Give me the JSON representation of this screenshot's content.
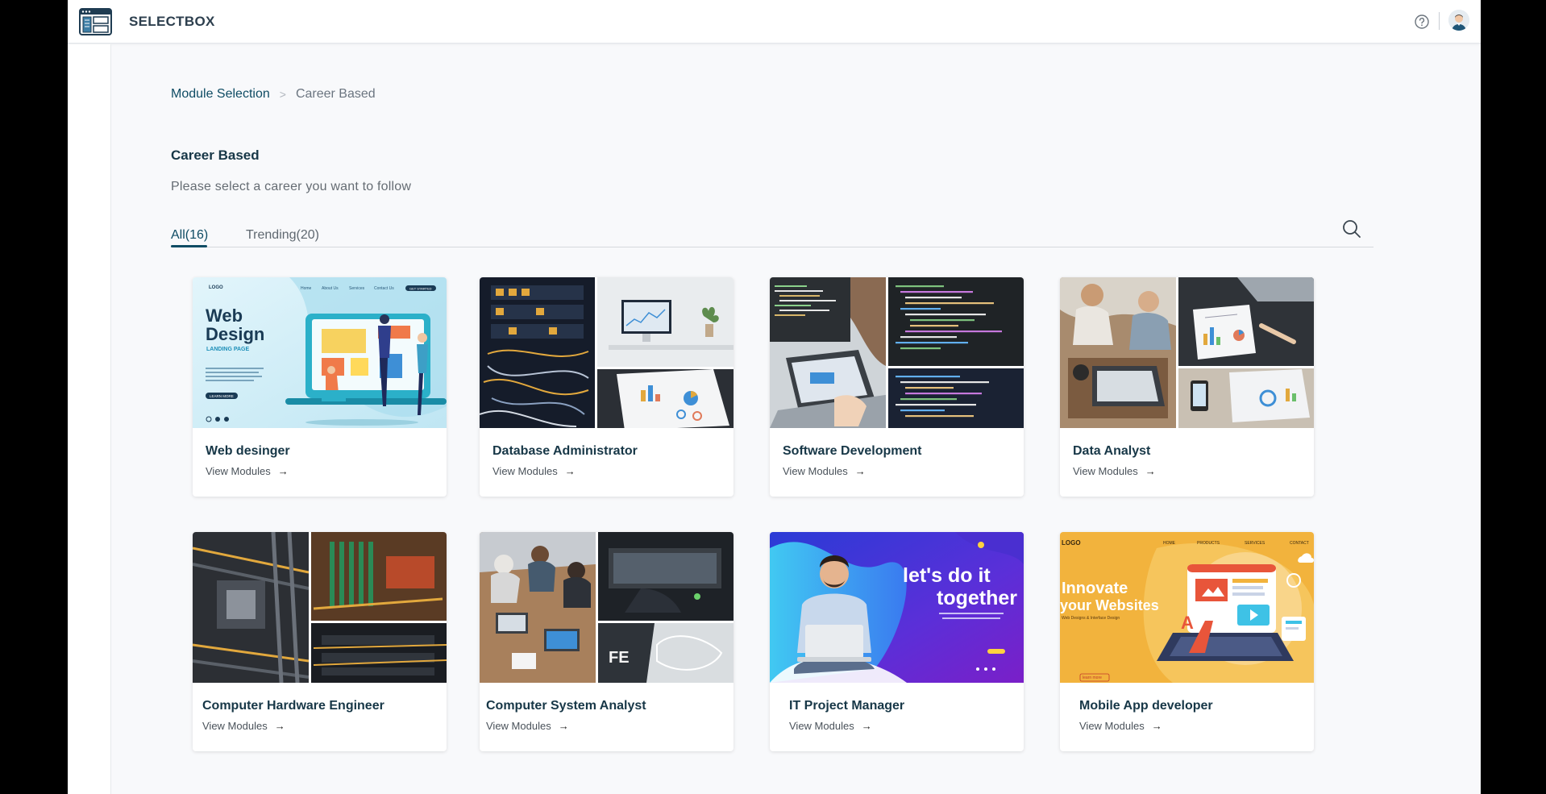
{
  "app": {
    "brand": "SELECTBOX"
  },
  "icons": {
    "logo": "layout-grid-icon",
    "help": "help-circle-icon",
    "avatar": "user-avatar-icon",
    "search": "search-icon",
    "arrow": "arrow-right-icon"
  },
  "colors": {
    "primary": "#0f4c64",
    "title": "#173747",
    "background": "#f8f9fb"
  },
  "breadcrumb": {
    "root": "Module Selection",
    "separator": ">",
    "current": "Career Based"
  },
  "page": {
    "title": "Career Based",
    "subtitle": "Please select a career you want to follow"
  },
  "tabs": [
    {
      "label": "All(16)",
      "active": true
    },
    {
      "label": "Trending(20)",
      "active": false
    }
  ],
  "cards": [
    {
      "title": "Web desinger",
      "link": "View Modules",
      "arrow": "→",
      "image": "web-design-landing-page-illustration"
    },
    {
      "title": "Database Administrator",
      "link": "View Modules",
      "arrow": "→",
      "image": "server-rack-and-desk-collage"
    },
    {
      "title": "Software Development",
      "link": "View Modules",
      "arrow": "→",
      "image": "code-on-screens-collage"
    },
    {
      "title": "Data Analyst",
      "link": "View Modules",
      "arrow": "→",
      "image": "charts-and-laptop-collage"
    },
    {
      "title": "Computer Hardware Engineer",
      "link": "View Modules",
      "arrow": "→",
      "image": "motherboard-collage"
    },
    {
      "title": "Computer System Analyst",
      "link": "View Modules",
      "arrow": "→",
      "image": "team-meeting-collage"
    },
    {
      "title": "IT Project Manager",
      "link": "View Modules",
      "arrow": "→",
      "image": "man-with-laptop-banner"
    },
    {
      "title": "Mobile App developer",
      "link": "View Modules",
      "arrow": "→",
      "image": "innovate-your-websites-illustration"
    }
  ],
  "image_text": {
    "web_design": {
      "logo": "LOGO",
      "nav": [
        "Home",
        "About Us",
        "Services",
        "Contact Us"
      ],
      "cta": "GET STARTED",
      "title_1": "Web",
      "title_2": "Design",
      "subtitle": "LANDING PAGE",
      "button": "LEARN MORE"
    },
    "it_pm": {
      "line_1": "let's do it",
      "line_2": "together"
    },
    "mobile": {
      "logo": "LOGO",
      "nav": [
        "HOME",
        "PRODUCTS",
        "SERVICES",
        "CONTACT"
      ],
      "line_1": "Innovate",
      "line_2": "your Websites",
      "sub": "Web Designs & Interface Design",
      "button": "learn more"
    },
    "analyst": {
      "fe": "FE"
    }
  }
}
